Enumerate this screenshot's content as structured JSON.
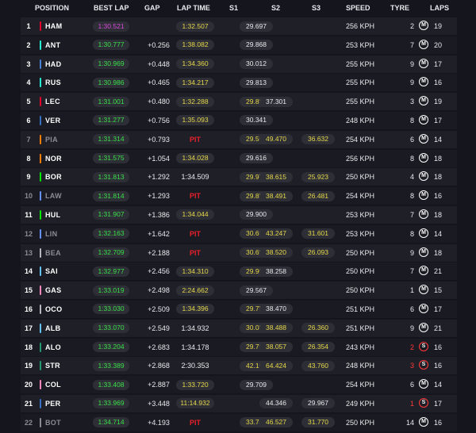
{
  "headers": {
    "position": "POSITION",
    "best_lap": "BEST LAP",
    "gap": "GAP",
    "lap_time": "LAP TIME",
    "s1": "S1",
    "s2": "S2",
    "s3": "S3",
    "speed": "SPEED",
    "tyre": "TYRE",
    "laps": "LAPS"
  },
  "colors": {
    "fastest_lap": "#d84adb",
    "personal_best": "#3ae04a",
    "improved": "#e5d84a",
    "pit": "#e8202a",
    "soft_tyre": "#ff3a3a",
    "medium_tyre": "#ffffff"
  },
  "rows": [
    {
      "pos": "1",
      "code": "HAM",
      "team": "#e8002d",
      "best": "1:30.521",
      "best_style": "purple",
      "gap": "",
      "lap": "1:32.507",
      "lap_style": "pill",
      "s1": "29.697",
      "s1_style": "",
      "s2": "",
      "s2_style": "",
      "s3": "",
      "s3_style": "",
      "speed": "256 KPH",
      "stint": "2",
      "tyre": "medium",
      "tyre_icon": "M",
      "laps": "19",
      "dim": false
    },
    {
      "pos": "2",
      "code": "ANT",
      "team": "#27f4d2",
      "best": "1:30.777",
      "best_style": "",
      "gap": "+0.256",
      "lap": "1:38.082",
      "lap_style": "pill",
      "s1": "29.868",
      "s1_style": "",
      "s2": "",
      "s2_style": "",
      "s3": "",
      "s3_style": "",
      "speed": "253 KPH",
      "stint": "7",
      "tyre": "medium",
      "tyre_icon": "M",
      "laps": "20",
      "dim": false
    },
    {
      "pos": "3",
      "code": "HAD",
      "team": "#4781d7",
      "best": "1:30.969",
      "best_style": "",
      "gap": "+0.448",
      "lap": "1:34.360",
      "lap_style": "pill",
      "s1": "30.012",
      "s1_style": "",
      "s2": "",
      "s2_style": "",
      "s3": "",
      "s3_style": "",
      "speed": "255 KPH",
      "stint": "9",
      "tyre": "medium",
      "tyre_icon": "M",
      "laps": "17",
      "dim": false
    },
    {
      "pos": "4",
      "code": "RUS",
      "team": "#27f4d2",
      "best": "1:30.986",
      "best_style": "",
      "gap": "+0.465",
      "lap": "1:34.217",
      "lap_style": "pill",
      "s1": "29.813",
      "s1_style": "",
      "s2": "",
      "s2_style": "",
      "s3": "",
      "s3_style": "",
      "speed": "255 KPH",
      "stint": "9",
      "tyre": "medium",
      "tyre_icon": "M",
      "laps": "16",
      "dim": false
    },
    {
      "pos": "5",
      "code": "LEC",
      "team": "#e8002d",
      "best": "1:31.001",
      "best_style": "",
      "gap": "+0.480",
      "lap": "1:32.288",
      "lap_style": "pill",
      "s1": "29.892",
      "s1_style": "yellow",
      "s2": "37.301",
      "s2_style": "",
      "s3": "",
      "s3_style": "",
      "speed": "255 KPH",
      "stint": "3",
      "tyre": "medium",
      "tyre_icon": "M",
      "laps": "19",
      "dim": false
    },
    {
      "pos": "6",
      "code": "VER",
      "team": "#3671c6",
      "best": "1:31.277",
      "best_style": "",
      "gap": "+0.756",
      "lap": "1:35.093",
      "lap_style": "pill",
      "s1": "30.341",
      "s1_style": "",
      "s2": "",
      "s2_style": "",
      "s3": "",
      "s3_style": "",
      "speed": "248 KPH",
      "stint": "8",
      "tyre": "medium",
      "tyre_icon": "M",
      "laps": "17",
      "dim": false
    },
    {
      "pos": "7",
      "code": "PIA",
      "team": "#ff8000",
      "best": "1:31.314",
      "best_style": "",
      "gap": "+0.793",
      "lap": "PIT",
      "lap_style": "pit",
      "s1": "29.563",
      "s1_style": "yellow",
      "s2": "49.470",
      "s2_style": "yellow",
      "s3": "36.632",
      "s3_style": "yellow",
      "speed": "254 KPH",
      "stint": "6",
      "tyre": "medium",
      "tyre_icon": "M",
      "laps": "14",
      "dim": true
    },
    {
      "pos": "8",
      "code": "NOR",
      "team": "#ff8000",
      "best": "1:31.575",
      "best_style": "",
      "gap": "+1.054",
      "lap": "1:34.028",
      "lap_style": "pill",
      "s1": "29.616",
      "s1_style": "",
      "s2": "",
      "s2_style": "",
      "s3": "",
      "s3_style": "",
      "speed": "256 KPH",
      "stint": "8",
      "tyre": "medium",
      "tyre_icon": "M",
      "laps": "18",
      "dim": false
    },
    {
      "pos": "9",
      "code": "BOR",
      "team": "#00e701",
      "best": "1:31.813",
      "best_style": "",
      "gap": "+1.292",
      "lap": "1:34.509",
      "lap_style": "plain",
      "s1": "29.971",
      "s1_style": "yellow",
      "s2": "38.615",
      "s2_style": "yellow",
      "s3": "25.923",
      "s3_style": "yellow",
      "speed": "250 KPH",
      "stint": "4",
      "tyre": "medium",
      "tyre_icon": "M",
      "laps": "18",
      "dim": false
    },
    {
      "pos": "10",
      "code": "LAW",
      "team": "#6692ff",
      "best": "1:31.814",
      "best_style": "",
      "gap": "+1.293",
      "lap": "PIT",
      "lap_style": "pit",
      "s1": "29.857",
      "s1_style": "yellow",
      "s2": "38.491",
      "s2_style": "yellow",
      "s3": "26.481",
      "s3_style": "yellow",
      "speed": "254 KPH",
      "stint": "8",
      "tyre": "medium",
      "tyre_icon": "M",
      "laps": "16",
      "dim": true
    },
    {
      "pos": "11",
      "code": "HUL",
      "team": "#00e701",
      "best": "1:31.907",
      "best_style": "",
      "gap": "+1.386",
      "lap": "1:34.044",
      "lap_style": "pill",
      "s1": "29.900",
      "s1_style": "",
      "s2": "",
      "s2_style": "",
      "s3": "",
      "s3_style": "",
      "speed": "253 KPH",
      "stint": "7",
      "tyre": "medium",
      "tyre_icon": "M",
      "laps": "18",
      "dim": false
    },
    {
      "pos": "12",
      "code": "LIN",
      "team": "#6692ff",
      "best": "1:32.163",
      "best_style": "",
      "gap": "+1.642",
      "lap": "PIT",
      "lap_style": "pit",
      "s1": "30.669",
      "s1_style": "yellow",
      "s2": "43.247",
      "s2_style": "yellow",
      "s3": "31.601",
      "s3_style": "yellow",
      "speed": "253 KPH",
      "stint": "8",
      "tyre": "medium",
      "tyre_icon": "M",
      "laps": "14",
      "dim": true
    },
    {
      "pos": "13",
      "code": "BEA",
      "team": "#b6babd",
      "best": "1:32.709",
      "best_style": "",
      "gap": "+2.188",
      "lap": "PIT",
      "lap_style": "pit",
      "s1": "30.694",
      "s1_style": "yellow",
      "s2": "38.520",
      "s2_style": "yellow",
      "s3": "26.093",
      "s3_style": "yellow",
      "speed": "250 KPH",
      "stint": "9",
      "tyre": "medium",
      "tyre_icon": "M",
      "laps": "18",
      "dim": true
    },
    {
      "pos": "14",
      "code": "SAI",
      "team": "#64c4ff",
      "best": "1:32.977",
      "best_style": "",
      "gap": "+2.456",
      "lap": "1:34.310",
      "lap_style": "pill",
      "s1": "29.905",
      "s1_style": "yellow",
      "s2": "38.258",
      "s2_style": "",
      "s3": "",
      "s3_style": "",
      "speed": "250 KPH",
      "stint": "7",
      "tyre": "medium",
      "tyre_icon": "M",
      "laps": "21",
      "dim": false
    },
    {
      "pos": "15",
      "code": "GAS",
      "team": "#ff87bc",
      "best": "1:33.019",
      "best_style": "",
      "gap": "+2.498",
      "lap": "2:24.662",
      "lap_style": "pill",
      "s1": "29.567",
      "s1_style": "",
      "s2": "",
      "s2_style": "",
      "s3": "",
      "s3_style": "",
      "speed": "250 KPH",
      "stint": "1",
      "tyre": "medium",
      "tyre_icon": "M",
      "laps": "15",
      "dim": false
    },
    {
      "pos": "16",
      "code": "OCO",
      "team": "#b6babd",
      "best": "1:33.030",
      "best_style": "",
      "gap": "+2.509",
      "lap": "1:34.396",
      "lap_style": "pill",
      "s1": "29.754",
      "s1_style": "yellow",
      "s2": "38.470",
      "s2_style": "",
      "s3": "",
      "s3_style": "",
      "speed": "251 KPH",
      "stint": "6",
      "tyre": "medium",
      "tyre_icon": "M",
      "laps": "17",
      "dim": false
    },
    {
      "pos": "17",
      "code": "ALB",
      "team": "#64c4ff",
      "best": "1:33.070",
      "best_style": "",
      "gap": "+2.549",
      "lap": "1:34.932",
      "lap_style": "plain",
      "s1": "30.084",
      "s1_style": "yellow",
      "s2": "38.488",
      "s2_style": "yellow",
      "s3": "26.360",
      "s3_style": "yellow",
      "speed": "251 KPH",
      "stint": "9",
      "tyre": "medium",
      "tyre_icon": "M",
      "laps": "21",
      "dim": false
    },
    {
      "pos": "18",
      "code": "ALO",
      "team": "#229971",
      "best": "1:33.204",
      "best_style": "",
      "gap": "+2.683",
      "lap": "1:34.178",
      "lap_style": "plain",
      "s1": "29.767",
      "s1_style": "yellow",
      "s2": "38.057",
      "s2_style": "yellow",
      "s3": "26.354",
      "s3_style": "yellow",
      "speed": "243 KPH",
      "stint": "2",
      "tyre": "soft",
      "tyre_icon": "S",
      "laps": "16",
      "dim": false
    },
    {
      "pos": "19",
      "code": "STR",
      "team": "#229971",
      "best": "1:33.389",
      "best_style": "",
      "gap": "+2.868",
      "lap": "2:30.353",
      "lap_style": "plain",
      "s1": "42.169",
      "s1_style": "yellow",
      "s2": "64.424",
      "s2_style": "yellow",
      "s3": "43.760",
      "s3_style": "yellow",
      "speed": "248 KPH",
      "stint": "3",
      "tyre": "soft",
      "tyre_icon": "S",
      "laps": "16",
      "dim": false
    },
    {
      "pos": "20",
      "code": "COL",
      "team": "#ff87bc",
      "best": "1:33.408",
      "best_style": "",
      "gap": "+2.887",
      "lap": "1:33.720",
      "lap_style": "pill",
      "s1": "29.709",
      "s1_style": "",
      "s2": "",
      "s2_style": "",
      "s3": "",
      "s3_style": "",
      "speed": "254 KPH",
      "stint": "6",
      "tyre": "medium",
      "tyre_icon": "M",
      "laps": "14",
      "dim": false
    },
    {
      "pos": "21",
      "code": "PER",
      "team": "#3671c6",
      "best": "1:33.969",
      "best_style": "",
      "gap": "+3.448",
      "lap": "11:14.932",
      "lap_style": "pill",
      "s1": "",
      "s1_style": "",
      "s2": "44.346",
      "s2_style": "",
      "s3": "29.967",
      "s3_style": "",
      "speed": "249 KPH",
      "stint": "1",
      "tyre": "soft",
      "tyre_icon": "S",
      "laps": "17",
      "dim": false
    },
    {
      "pos": "22",
      "code": "BOT",
      "team": "#8b8b93",
      "best": "1:34.714",
      "best_style": "",
      "gap": "+4.193",
      "lap": "PIT",
      "lap_style": "pit",
      "s1": "33.741",
      "s1_style": "yellow",
      "s2": "46.527",
      "s2_style": "yellow",
      "s3": "31.770",
      "s3_style": "yellow",
      "speed": "250 KPH",
      "stint": "14",
      "tyre": "medium",
      "tyre_icon": "M",
      "laps": "16",
      "dim": true
    }
  ]
}
